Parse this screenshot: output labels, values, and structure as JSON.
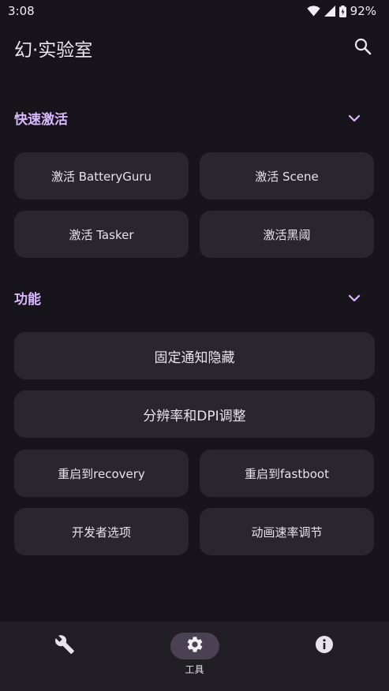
{
  "status_bar": {
    "time": "3:08",
    "battery_percent": "92%",
    "icons": [
      "wifi-icon",
      "signal-icon",
      "battery-icon"
    ]
  },
  "app_bar": {
    "title": "幻·实验室",
    "search_icon": "search-icon"
  },
  "sections": {
    "quick_activate": {
      "title": "快速激活",
      "buttons": [
        "激活 BatteryGuru",
        "激活 Scene",
        "激活 Tasker",
        "激活黑阈"
      ]
    },
    "features": {
      "title": "功能",
      "wide_buttons": [
        "固定通知隐藏",
        "分辨率和DPI调整"
      ],
      "buttons": [
        "重启到recovery",
        "重启到fastboot",
        "开发者选项",
        "动画速率调节"
      ]
    }
  },
  "bottom_nav": {
    "items": [
      {
        "icon": "wrench-icon",
        "label": ""
      },
      {
        "icon": "gear-icon",
        "label": "工具"
      },
      {
        "icon": "info-icon",
        "label": ""
      }
    ],
    "active_index": 1
  },
  "colors": {
    "background": "#17141b",
    "card": "#2a262e",
    "accent": "#d9b8ff",
    "nav_bg": "#221e26",
    "nav_active": "#4a4152"
  }
}
